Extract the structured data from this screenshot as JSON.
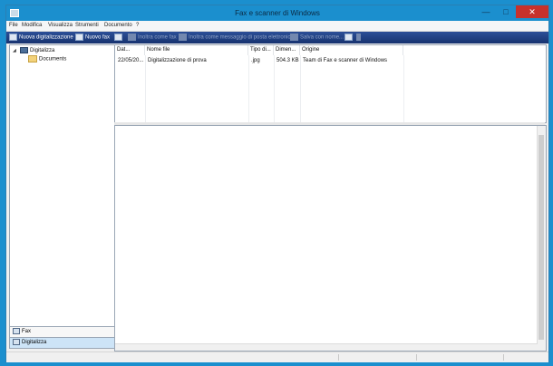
{
  "window": {
    "title": "Fax e scanner di Windows"
  },
  "title_controls": {
    "minimize": "—",
    "maximize": "□",
    "close": "✕"
  },
  "menu": [
    "File",
    "Modifica",
    "Visualizza",
    "Strumenti",
    "Documento",
    "?"
  ],
  "toolbar": {
    "new_scan": "Nuova digitalizzazione",
    "new_fax": "Nuovo fax",
    "forward_fax": "Inoltra come fax",
    "forward_email": "Inoltra come messaggio di posta elettronica",
    "save_as": "Salva con nome...",
    "print_icon": "printer-icon"
  },
  "tree": {
    "root": "Digitalizza",
    "child": "Documents"
  },
  "nav": {
    "fax": "Fax",
    "scan": "Digitalizza"
  },
  "list": {
    "columns": [
      "Dat...",
      "Nome file",
      "Tipo di...",
      "Dimen...",
      "Origine"
    ],
    "rows": [
      {
        "date": "22/05/20...",
        "name": "Digitalizzazione di prova",
        "type": ".jpg",
        "size": "504.3 KB",
        "source": "Team di Fax e scanner di Windows"
      }
    ]
  },
  "colors": {
    "accent": "#1b8fce",
    "toolbar": "#1f3f85",
    "close": "#c7312b",
    "nav_selected": "#cde4f7"
  }
}
